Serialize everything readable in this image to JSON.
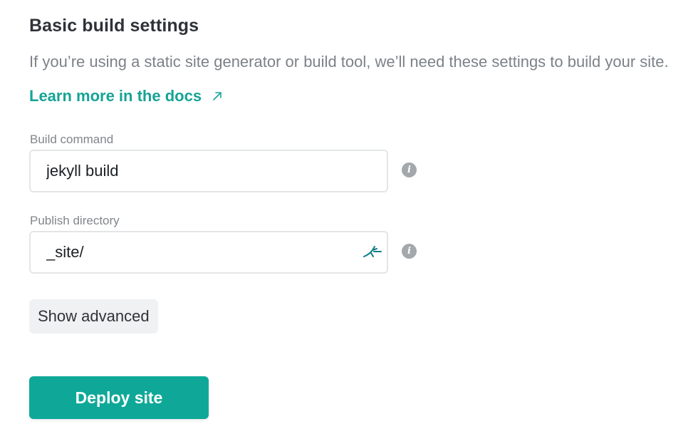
{
  "section": {
    "title": "Basic build settings",
    "intro_text": "If you’re using a static site generator or build tool, we’ll need these settings to build your site.",
    "docs_link_label": "Learn more in the docs",
    "docs_link_icon": "external-arrow-icon"
  },
  "build_command": {
    "label": "Build command",
    "value": "jekyll build",
    "info_icon": "info-icon"
  },
  "publish_directory": {
    "label": "Publish directory",
    "value": "_site/",
    "trailing_icon": "netlify-deer-icon",
    "info_icon": "info-icon"
  },
  "advanced": {
    "label": "Show advanced"
  },
  "deploy": {
    "label": "Deploy site"
  },
  "colors": {
    "accent": "#0fa898",
    "link": "#16a396",
    "muted_text": "#7c8288",
    "info_icon": "#a3a8ad"
  }
}
